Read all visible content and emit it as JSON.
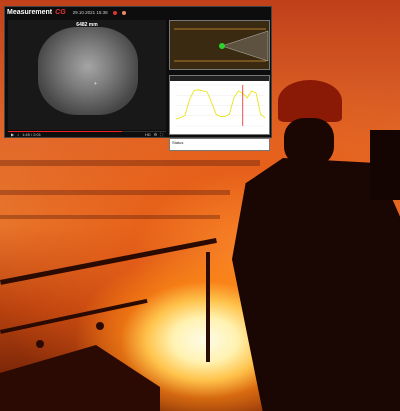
{
  "app": {
    "title": "Measurement",
    "brand": "CG",
    "timestamp": "29.10.2021 15:38"
  },
  "video": {
    "distance": "6482 mm",
    "marker": "+",
    "progress": 0.72
  },
  "controls": {
    "play_icon": "play-icon",
    "time": "1:45 / 2:01",
    "hd_label": "HD",
    "fullscreen_icon": "fullscreen-icon"
  },
  "info": {
    "label": "Status"
  },
  "chart_data": {
    "type": "line",
    "series": [
      {
        "color": "#e8e000",
        "values": [
          6,
          7,
          9,
          22,
          30,
          31,
          30,
          29,
          20,
          10,
          8,
          8,
          10,
          24,
          30,
          28,
          24,
          30,
          28,
          10,
          7
        ]
      }
    ],
    "markers": [
      {
        "index": 15,
        "color": "#e22"
      }
    ],
    "grid": true
  },
  "colors": {
    "brand": "#e33333",
    "accent": "#e22222",
    "chart_line": "#e8e000"
  }
}
